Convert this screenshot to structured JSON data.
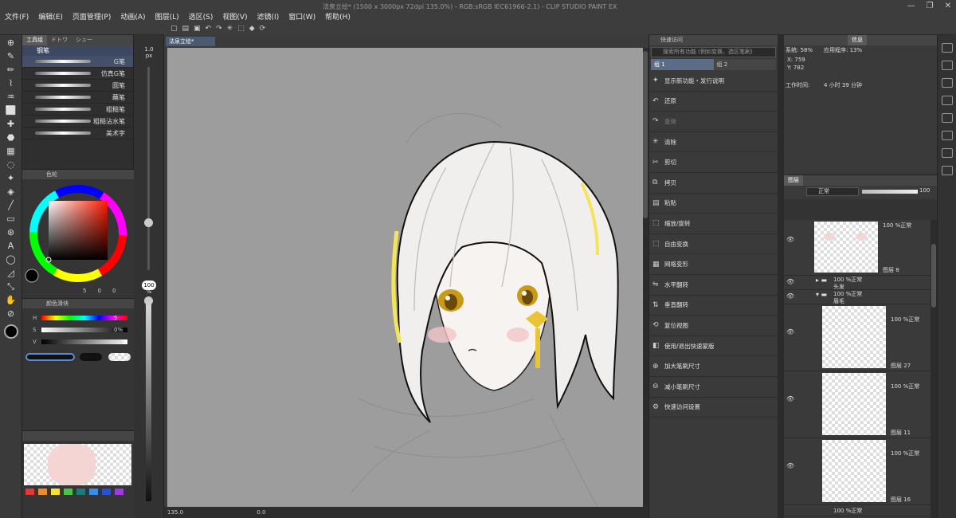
{
  "app": {
    "title": "法泉立绘* (1500 x 3000px 72dpi 135.0%) - RGB:sRGB IEC61966-2.1) - CLIP STUDIO PAINT EX",
    "doc_tab": "法泉立绘*"
  },
  "menu": [
    "文件(F)",
    "编辑(E)",
    "页面管理(P)",
    "动画(A)",
    "图层(L)",
    "选区(S)",
    "视图(V)",
    "滤镜(I)",
    "窗口(W)",
    "帮助(H)"
  ],
  "subtool": {
    "tabs": [
      "工具组",
      "ドトワ",
      "シュー"
    ],
    "active_tab": "钢笔",
    "brushes": [
      "G笔",
      "仿真G笔",
      "圆笔",
      "蘸笔",
      "粗糙笔",
      "粗糙沾水笔",
      "美术字"
    ]
  },
  "color": {
    "header": "色轮",
    "h_label": "H",
    "s_label": "S",
    "v_label": "V",
    "h_value": "5",
    "s_value": "0%",
    "v_value": "0%",
    "wheel_values": [
      "5",
      "0",
      "0"
    ],
    "mixer_header": "颜色滑块"
  },
  "brushsize": {
    "size": "1.0",
    "unit": "px",
    "opacity": "100",
    "opacity_unit": "%"
  },
  "status": {
    "zoom": "135.0",
    "angle": "0.0"
  },
  "quick": {
    "header": "快速访问",
    "search": "搜索所有功能 (例如变换、选区笔刷)",
    "tabs": [
      "组 1",
      "组 2"
    ],
    "items": [
      {
        "label": "显示新功能・发行说明",
        "enabled": true
      },
      {
        "label": "还原",
        "enabled": true
      },
      {
        "label": "重做",
        "enabled": false
      },
      {
        "label": "清除",
        "enabled": true
      },
      {
        "label": "剪切",
        "enabled": true
      },
      {
        "label": "拷贝",
        "enabled": true
      },
      {
        "label": "粘贴",
        "enabled": true
      },
      {
        "label": "缩放/旋转",
        "enabled": true
      },
      {
        "label": "自由变换",
        "enabled": true
      },
      {
        "label": "网格变形",
        "enabled": true
      },
      {
        "label": "水平翻转",
        "enabled": true
      },
      {
        "label": "垂直翻转",
        "enabled": true
      },
      {
        "label": "复位视图",
        "enabled": true
      },
      {
        "label": "使用/退出快速蒙版",
        "enabled": true
      },
      {
        "label": "加大笔刷尺寸",
        "enabled": true
      },
      {
        "label": "减小笔刷尺寸",
        "enabled": true
      },
      {
        "label": "快速访问设置",
        "enabled": true
      }
    ]
  },
  "info": {
    "tabs": [
      "",
      "",
      "信息"
    ],
    "system": "系统: 58%",
    "app_usage": "应用程序: 13%",
    "x": "X: 759",
    "y": "Y: 782",
    "work_time": "工作时间:",
    "work_value": "4 小时 39 分钟"
  },
  "layers": {
    "header": "图层",
    "blend_mode": "正常",
    "opacity": "100",
    "rows": [
      {
        "name": "图层 8",
        "mode": "100 %正常"
      },
      {
        "name": "头发",
        "mode": "100 %正常"
      },
      {
        "name": "眉毛",
        "mode": "100 %正常"
      },
      {
        "name": "图层 27",
        "mode": "100 %正常"
      },
      {
        "name": "图层 11",
        "mode": "100 %正常"
      },
      {
        "name": "图层 16",
        "mode": "100 %正常"
      },
      {
        "name": "",
        "mode": "100 %正常"
      }
    ]
  },
  "colors": {
    "accent": "#5c6b86",
    "canvas_bg": "#9d9d9d",
    "hair_highlight": "#f3e45b"
  }
}
